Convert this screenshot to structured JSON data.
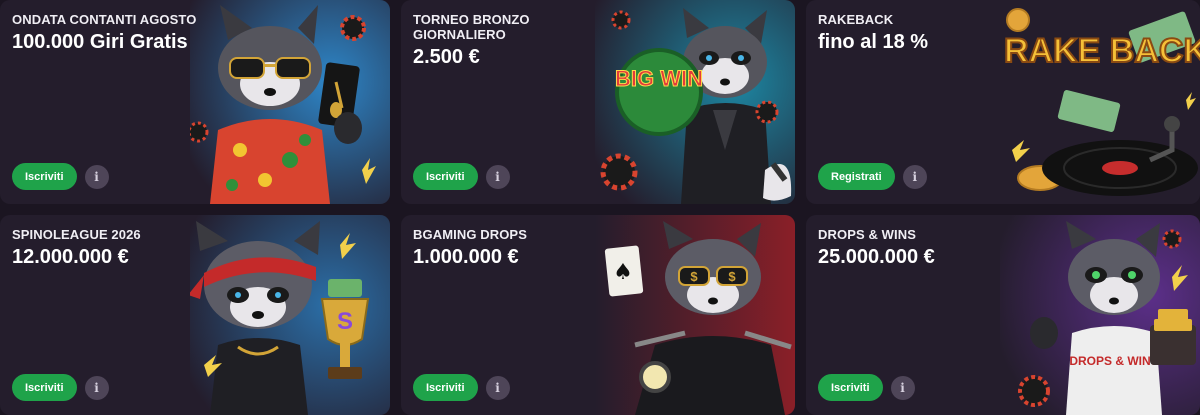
{
  "promotions": [
    {
      "title": "ONDATA CONTANTI AGOSTO",
      "amount": "100.000 Giri Gratis",
      "button": "Iscriviti",
      "info": "i",
      "bg": "#1d4f86",
      "mascot": "raccoon-with-sunglasses-guitar-card-icon"
    },
    {
      "title": "TORNEO BRONZO GIORNALIERO",
      "amount": "2.500 €",
      "button": "Iscriviti",
      "info": "i",
      "bg": "#0e4f63",
      "mascot": "raccoon-big-win-watermelon-icon",
      "art_text": "BIG WIN"
    },
    {
      "title": "RAKEBACK",
      "amount": "fino al 18 %",
      "button": "Registrati",
      "info": "i",
      "bg": "#2c2434",
      "mascot": "rakeback-vinyl-record-icon",
      "art_text": "RAKE BACK"
    },
    {
      "title": "SPINOLEAGUE 2026",
      "amount": "12.000.000 €",
      "button": "Iscriviti",
      "info": "i",
      "bg": "#1c3f6b",
      "mascot": "raccoon-trophy-bandana-icon",
      "art_text": "S"
    },
    {
      "title": "BGAMING DROPS",
      "amount": "1.000.000 €",
      "button": "Iscriviti",
      "info": "i",
      "bg": "#6d1c22",
      "mascot": "raccoon-motorcycle-ace-card-icon"
    },
    {
      "title": "DROPS & WINS",
      "amount": "25.000.000 €",
      "button": "Iscriviti",
      "info": "i",
      "bg": "#4a2a6e",
      "mascot": "raccoon-drops-wins-gold-icon",
      "art_text": "DROPS & WINS"
    }
  ],
  "colors": {
    "page_bg": "#1b1521",
    "card_bg": "#241d2c",
    "button_green": "#1fa34a",
    "info_bg": "#4e4558"
  }
}
